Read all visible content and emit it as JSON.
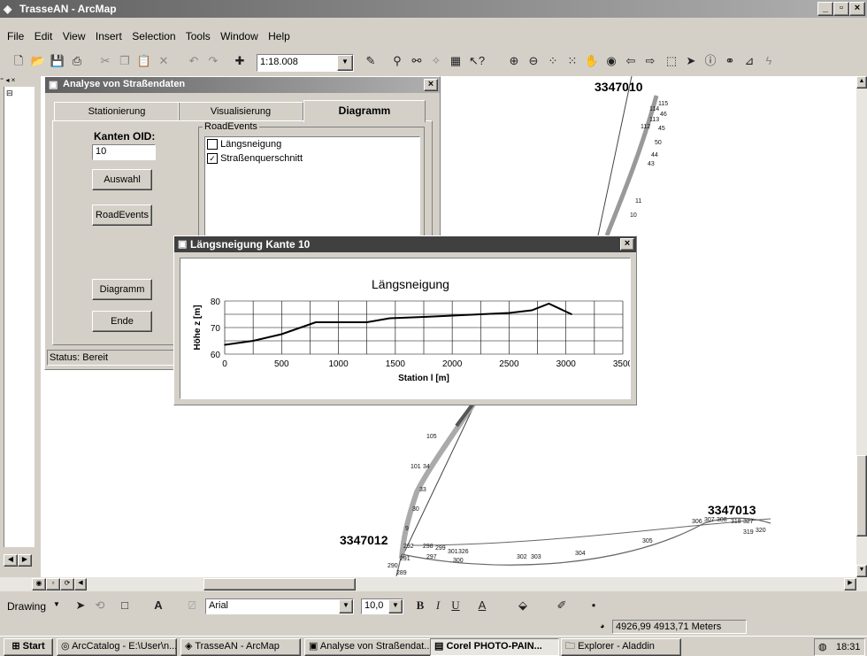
{
  "app": {
    "title": "TrasseAN - ArcMap"
  },
  "menu": [
    "File",
    "Edit",
    "View",
    "Insert",
    "Selection",
    "Tools",
    "Window",
    "Help"
  ],
  "toolbar": {
    "scale": "1:18.008"
  },
  "dialog": {
    "title": "Analyse von Straßendaten",
    "tabs": [
      "Stationierung",
      "Visualisierung",
      "Diagramm"
    ],
    "kanten_label": "Kanten OID:",
    "kanten_value": "10",
    "auswahl": "Auswahl",
    "roadevents_btn": "RoadEvents",
    "diagramm_btn": "Diagramm",
    "ende_btn": "Ende",
    "group_label": "RoadEvents",
    "items": [
      {
        "label": "Längsneigung",
        "checked": false
      },
      {
        "label": "Straßenquerschnitt",
        "checked": true
      }
    ],
    "status": "Status: Bereit"
  },
  "chart_window": {
    "title": "Längsneigung Kante 10"
  },
  "chart_data": {
    "type": "line",
    "title": "Längsneigung",
    "xlabel": "Station l [m]",
    "ylabel": "Höhe z [m]",
    "xlim": [
      0,
      3500
    ],
    "ylim": [
      60,
      80
    ],
    "xticks": [
      "0",
      "500",
      "1000",
      "1500",
      "2000",
      "2500",
      "3000",
      "3500"
    ],
    "yticks": [
      "60",
      "70",
      "80"
    ],
    "grid": true,
    "x": [
      0,
      250,
      500,
      800,
      1000,
      1250,
      1450,
      1750,
      2000,
      2250,
      2500,
      2700,
      2850,
      3050
    ],
    "y": [
      63.5,
      65,
      67.5,
      72,
      72,
      72,
      73.5,
      74,
      74.5,
      75,
      75.5,
      76.5,
      79,
      75
    ]
  },
  "map": {
    "labels": [
      "3347010",
      "3347012",
      "3347013"
    ],
    "points": [
      "115",
      "114",
      "46",
      "113",
      "112",
      "45",
      "50",
      "44",
      "43",
      "11",
      "10",
      "105",
      "101",
      "34",
      "33",
      "30",
      "9",
      "292",
      "298",
      "299",
      "297",
      "301",
      "326",
      "300",
      "291",
      "290",
      "289",
      "302",
      "303",
      "304",
      "305",
      "306",
      "307",
      "308",
      "318",
      "327",
      "319",
      "320"
    ]
  },
  "drawing": {
    "label": "Drawing",
    "font": "Arial",
    "size": "10,0",
    "bold": "B",
    "italic": "I",
    "underline": "U"
  },
  "statusbar": {
    "coords": "4926,99  4913,71 Meters"
  },
  "taskbar": {
    "start": "Start",
    "items": [
      "ArcCatalog - E:\\User\\n...",
      "TrasseAN - ArcMap",
      "Analyse von Straßendat...",
      "Corel PHOTO-PAIN...",
      "Explorer - Aladdin"
    ],
    "time": "18:31"
  }
}
